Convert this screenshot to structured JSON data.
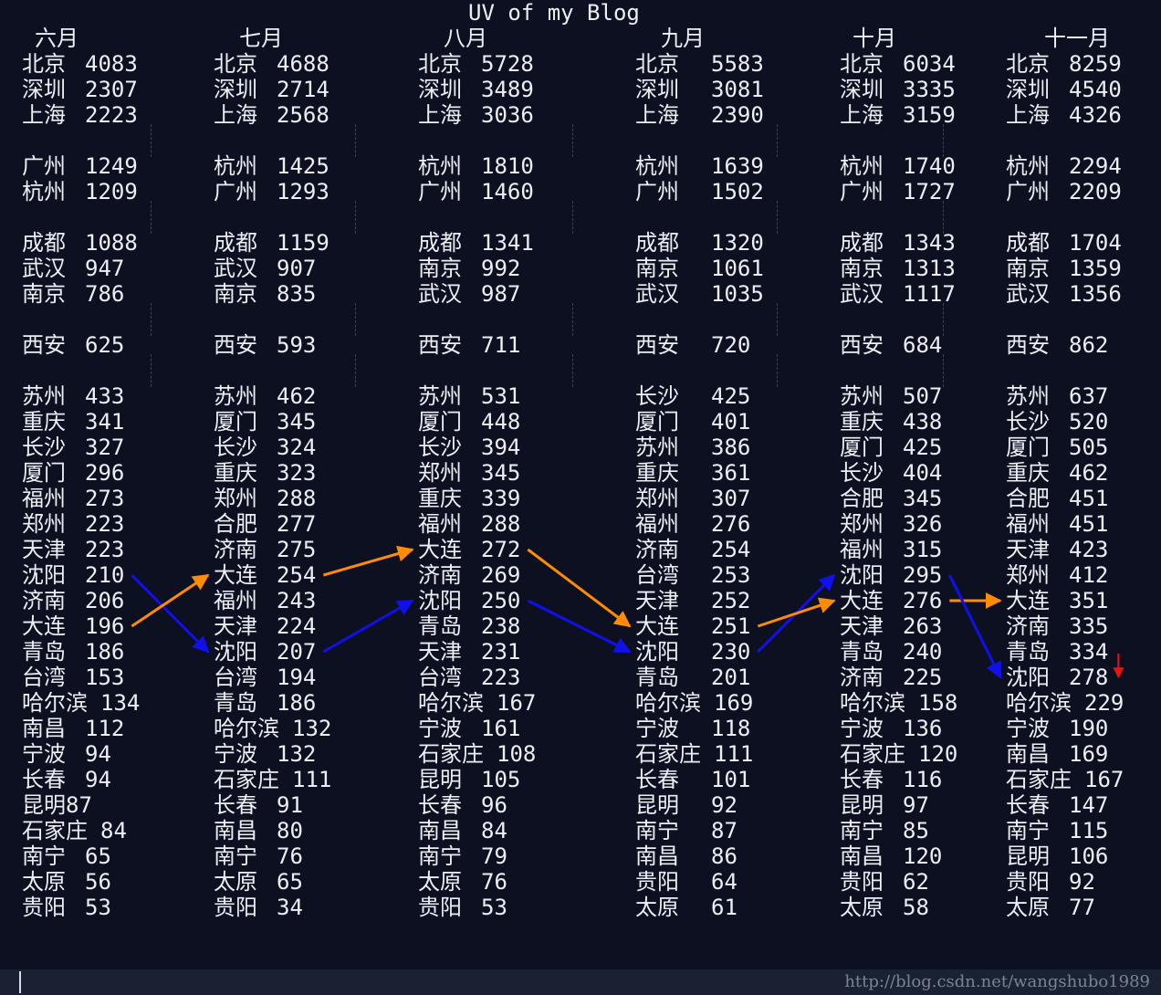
{
  "title": "UV of my Blog",
  "watermark": "http://blog.csdn.net/wangshubo1989",
  "months": [
    {
      "name": "六月",
      "rows": [
        {
          "city": "北京",
          "value": "4083"
        },
        {
          "city": "深圳",
          "value": "2307"
        },
        {
          "city": "上海",
          "value": "2223"
        },
        {
          "city": "",
          "value": ""
        },
        {
          "city": "广州",
          "value": "1249"
        },
        {
          "city": "杭州",
          "value": "1209"
        },
        {
          "city": "",
          "value": ""
        },
        {
          "city": "成都",
          "value": "1088"
        },
        {
          "city": "武汉",
          "value": "947"
        },
        {
          "city": "南京",
          "value": "786"
        },
        {
          "city": "",
          "value": ""
        },
        {
          "city": "西安",
          "value": "625"
        },
        {
          "city": "",
          "value": ""
        },
        {
          "city": "苏州",
          "value": "433"
        },
        {
          "city": "重庆",
          "value": "341"
        },
        {
          "city": "长沙",
          "value": "327"
        },
        {
          "city": "厦门",
          "value": "296"
        },
        {
          "city": "福州",
          "value": "273"
        },
        {
          "city": "郑州",
          "value": "223"
        },
        {
          "city": "天津",
          "value": "223"
        },
        {
          "city": "沈阳",
          "value": "210"
        },
        {
          "city": "济南",
          "value": "206"
        },
        {
          "city": "大连",
          "value": "196"
        },
        {
          "city": "青岛",
          "value": "186"
        },
        {
          "city": "台湾",
          "value": "153"
        },
        {
          "city": "哈尔滨",
          "value": "134"
        },
        {
          "city": "南昌",
          "value": "112"
        },
        {
          "city": "宁波",
          "value": "94"
        },
        {
          "city": "长春",
          "value": "94"
        },
        {
          "city": "昆明",
          "value": "87"
        },
        {
          "city": "石家庄",
          "value": "84"
        },
        {
          "city": "南宁",
          "value": "65"
        },
        {
          "city": "太原",
          "value": "56"
        },
        {
          "city": "贵阳",
          "value": "53"
        }
      ]
    },
    {
      "name": "七月",
      "rows": [
        {
          "city": "北京",
          "value": "4688"
        },
        {
          "city": "深圳",
          "value": "2714"
        },
        {
          "city": "上海",
          "value": "2568"
        },
        {
          "city": "",
          "value": ""
        },
        {
          "city": "杭州",
          "value": "1425"
        },
        {
          "city": "广州",
          "value": "1293"
        },
        {
          "city": "",
          "value": ""
        },
        {
          "city": "成都",
          "value": "1159"
        },
        {
          "city": "武汉",
          "value": "907"
        },
        {
          "city": "南京",
          "value": "835"
        },
        {
          "city": "",
          "value": ""
        },
        {
          "city": "西安",
          "value": "593"
        },
        {
          "city": "",
          "value": ""
        },
        {
          "city": "苏州",
          "value": "462"
        },
        {
          "city": "厦门",
          "value": "345"
        },
        {
          "city": "长沙",
          "value": "324"
        },
        {
          "city": "重庆",
          "value": "323"
        },
        {
          "city": "郑州",
          "value": "288"
        },
        {
          "city": "合肥",
          "value": "277"
        },
        {
          "city": "济南",
          "value": "275"
        },
        {
          "city": "大连",
          "value": "254"
        },
        {
          "city": "福州",
          "value": "243"
        },
        {
          "city": "天津",
          "value": "224"
        },
        {
          "city": "沈阳",
          "value": "207"
        },
        {
          "city": "台湾",
          "value": "194"
        },
        {
          "city": "青岛",
          "value": "186"
        },
        {
          "city": "哈尔滨",
          "value": "132"
        },
        {
          "city": "宁波",
          "value": "132"
        },
        {
          "city": "石家庄",
          "value": "111"
        },
        {
          "city": "长春",
          "value": "91"
        },
        {
          "city": "南昌",
          "value": "80"
        },
        {
          "city": "南宁",
          "value": "76"
        },
        {
          "city": "太原",
          "value": "65"
        },
        {
          "city": "贵阳",
          "value": "34"
        }
      ]
    },
    {
      "name": "八月",
      "rows": [
        {
          "city": "北京",
          "value": "5728"
        },
        {
          "city": "深圳",
          "value": "3489"
        },
        {
          "city": "上海",
          "value": "3036"
        },
        {
          "city": "",
          "value": ""
        },
        {
          "city": "杭州",
          "value": "1810"
        },
        {
          "city": "广州",
          "value": "1460"
        },
        {
          "city": "",
          "value": ""
        },
        {
          "city": "成都",
          "value": "1341"
        },
        {
          "city": "南京",
          "value": "992"
        },
        {
          "city": "武汉",
          "value": "987"
        },
        {
          "city": "",
          "value": ""
        },
        {
          "city": "西安",
          "value": "711"
        },
        {
          "city": "",
          "value": ""
        },
        {
          "city": "苏州",
          "value": "531"
        },
        {
          "city": "厦门",
          "value": "448"
        },
        {
          "city": "长沙",
          "value": "394"
        },
        {
          "city": "郑州",
          "value": "345"
        },
        {
          "city": "重庆",
          "value": "339"
        },
        {
          "city": "福州",
          "value": "288"
        },
        {
          "city": "大连",
          "value": "272"
        },
        {
          "city": "济南",
          "value": "269"
        },
        {
          "city": "沈阳",
          "value": "250"
        },
        {
          "city": "青岛",
          "value": "238"
        },
        {
          "city": "天津",
          "value": "231"
        },
        {
          "city": "台湾",
          "value": "223"
        },
        {
          "city": "哈尔滨",
          "value": "167"
        },
        {
          "city": "宁波",
          "value": "161"
        },
        {
          "city": "石家庄",
          "value": "108"
        },
        {
          "city": "昆明",
          "value": "105"
        },
        {
          "city": "长春",
          "value": "96"
        },
        {
          "city": "南昌",
          "value": "84"
        },
        {
          "city": "南宁",
          "value": "79"
        },
        {
          "city": "太原",
          "value": "76"
        },
        {
          "city": "贵阳",
          "value": "53"
        }
      ]
    },
    {
      "name": "九月",
      "rows": [
        {
          "city": "北京",
          "value": "5583"
        },
        {
          "city": "深圳",
          "value": "3081"
        },
        {
          "city": "上海",
          "value": "2390"
        },
        {
          "city": "",
          "value": ""
        },
        {
          "city": "杭州",
          "value": "1639"
        },
        {
          "city": "广州",
          "value": "1502"
        },
        {
          "city": "",
          "value": ""
        },
        {
          "city": "成都",
          "value": "1320"
        },
        {
          "city": "南京",
          "value": "1061"
        },
        {
          "city": "武汉",
          "value": "1035"
        },
        {
          "city": "",
          "value": ""
        },
        {
          "city": "西安",
          "value": "720"
        },
        {
          "city": "",
          "value": ""
        },
        {
          "city": "长沙",
          "value": "425"
        },
        {
          "city": "厦门",
          "value": "401"
        },
        {
          "city": "苏州",
          "value": "386"
        },
        {
          "city": "重庆",
          "value": "361"
        },
        {
          "city": "郑州",
          "value": "307"
        },
        {
          "city": "福州",
          "value": "276"
        },
        {
          "city": "济南",
          "value": "254"
        },
        {
          "city": "台湾",
          "value": "253"
        },
        {
          "city": "天津",
          "value": "252"
        },
        {
          "city": "大连",
          "value": "251"
        },
        {
          "city": "沈阳",
          "value": "230"
        },
        {
          "city": "青岛",
          "value": "201"
        },
        {
          "city": "哈尔滨",
          "value": "169"
        },
        {
          "city": "宁波",
          "value": "118"
        },
        {
          "city": "石家庄",
          "value": "111"
        },
        {
          "city": "长春",
          "value": "101"
        },
        {
          "city": "昆明",
          "value": "92"
        },
        {
          "city": "南宁",
          "value": "87"
        },
        {
          "city": "南昌",
          "value": "86"
        },
        {
          "city": "贵阳",
          "value": "64"
        },
        {
          "city": "太原",
          "value": "61"
        }
      ]
    },
    {
      "name": "十月",
      "rows": [
        {
          "city": "北京",
          "value": "6034"
        },
        {
          "city": "深圳",
          "value": "3335"
        },
        {
          "city": "上海",
          "value": "3159"
        },
        {
          "city": "",
          "value": ""
        },
        {
          "city": "杭州",
          "value": "1740"
        },
        {
          "city": "广州",
          "value": "1727"
        },
        {
          "city": "",
          "value": ""
        },
        {
          "city": "成都",
          "value": "1343"
        },
        {
          "city": "南京",
          "value": "1313"
        },
        {
          "city": "武汉",
          "value": "1117"
        },
        {
          "city": "",
          "value": ""
        },
        {
          "city": "西安",
          "value": "684"
        },
        {
          "city": "",
          "value": ""
        },
        {
          "city": "苏州",
          "value": "507"
        },
        {
          "city": "重庆",
          "value": "438"
        },
        {
          "city": "厦门",
          "value": "425"
        },
        {
          "city": "长沙",
          "value": "404"
        },
        {
          "city": "合肥",
          "value": "345"
        },
        {
          "city": "郑州",
          "value": "326"
        },
        {
          "city": "福州",
          "value": "315"
        },
        {
          "city": "沈阳",
          "value": "295"
        },
        {
          "city": "大连",
          "value": "276"
        },
        {
          "city": "天津",
          "value": "263"
        },
        {
          "city": "青岛",
          "value": "240"
        },
        {
          "city": "济南",
          "value": "225"
        },
        {
          "city": "哈尔滨",
          "value": "158"
        },
        {
          "city": "宁波",
          "value": "136"
        },
        {
          "city": "石家庄",
          "value": "120"
        },
        {
          "city": "长春",
          "value": "116"
        },
        {
          "city": "昆明",
          "value": "97"
        },
        {
          "city": "南宁",
          "value": "85"
        },
        {
          "city": "南昌",
          "value": "120"
        },
        {
          "city": "贵阳",
          "value": "62"
        },
        {
          "city": "太原",
          "value": "58"
        }
      ]
    },
    {
      "name": "十一月",
      "rows": [
        {
          "city": "北京",
          "value": "8259"
        },
        {
          "city": "深圳",
          "value": "4540"
        },
        {
          "city": "上海",
          "value": "4326"
        },
        {
          "city": "",
          "value": ""
        },
        {
          "city": "杭州",
          "value": "2294"
        },
        {
          "city": "广州",
          "value": "2209"
        },
        {
          "city": "",
          "value": ""
        },
        {
          "city": "成都",
          "value": "1704"
        },
        {
          "city": "南京",
          "value": "1359"
        },
        {
          "city": "武汉",
          "value": "1356"
        },
        {
          "city": "",
          "value": ""
        },
        {
          "city": "西安",
          "value": "862"
        },
        {
          "city": "",
          "value": ""
        },
        {
          "city": "苏州",
          "value": "637"
        },
        {
          "city": "长沙",
          "value": "520"
        },
        {
          "city": "厦门",
          "value": "505"
        },
        {
          "city": "重庆",
          "value": "462"
        },
        {
          "city": "合肥",
          "value": "451"
        },
        {
          "city": "福州",
          "value": "451"
        },
        {
          "city": "天津",
          "value": "423"
        },
        {
          "city": "郑州",
          "value": "412"
        },
        {
          "city": "大连",
          "value": "351"
        },
        {
          "city": "济南",
          "value": "335"
        },
        {
          "city": "青岛",
          "value": "334"
        },
        {
          "city": "沈阳",
          "value": "278"
        },
        {
          "city": "哈尔滨",
          "value": "229"
        },
        {
          "city": "宁波",
          "value": "190"
        },
        {
          "city": "南昌",
          "value": "169"
        },
        {
          "city": "石家庄",
          "value": "167"
        },
        {
          "city": "长春",
          "value": "147"
        },
        {
          "city": "南宁",
          "value": "115"
        },
        {
          "city": "昆明",
          "value": "106"
        },
        {
          "city": "贵阳",
          "value": "92"
        },
        {
          "city": "太原",
          "value": "77"
        }
      ]
    }
  ],
  "annotations": {
    "arrow_colors": {
      "orange": "#ff8c00",
      "blue": "#1010ee",
      "red": "#ee1111"
    },
    "arrows": [
      {
        "color": "blue",
        "from": {
          "month": 0,
          "city": "沈阳"
        },
        "to": {
          "month": 1,
          "city": "沈阳"
        }
      },
      {
        "color": "orange",
        "from": {
          "month": 0,
          "city": "大连"
        },
        "to": {
          "month": 1,
          "city": "大连"
        }
      },
      {
        "color": "orange",
        "from": {
          "month": 1,
          "city": "大连"
        },
        "to": {
          "month": 2,
          "city": "大连"
        }
      },
      {
        "color": "blue",
        "from": {
          "month": 1,
          "city": "沈阳"
        },
        "to": {
          "month": 2,
          "city": "沈阳"
        }
      },
      {
        "color": "orange",
        "from": {
          "month": 2,
          "city": "大连"
        },
        "to": {
          "month": 3,
          "city": "大连"
        }
      },
      {
        "color": "blue",
        "from": {
          "month": 2,
          "city": "沈阳"
        },
        "to": {
          "month": 3,
          "city": "沈阳"
        }
      },
      {
        "color": "blue",
        "from": {
          "month": 3,
          "city": "沈阳"
        },
        "to": {
          "month": 4,
          "city": "沈阳"
        }
      },
      {
        "color": "orange",
        "from": {
          "month": 3,
          "city": "大连"
        },
        "to": {
          "month": 4,
          "city": "大连"
        }
      },
      {
        "color": "orange",
        "from": {
          "month": 4,
          "city": "大连"
        },
        "to": {
          "month": 5,
          "city": "大连"
        }
      },
      {
        "color": "blue",
        "from": {
          "month": 4,
          "city": "沈阳"
        },
        "to": {
          "month": 5,
          "city": "沈阳"
        }
      }
    ],
    "marker": {
      "color": "red",
      "month": 5,
      "city": "哈尔滨"
    }
  }
}
